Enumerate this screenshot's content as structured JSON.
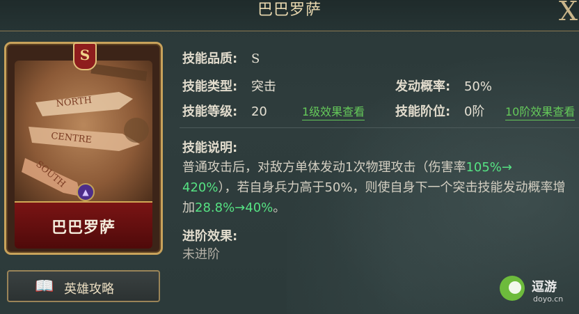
{
  "header": {
    "title": "巴巴罗萨"
  },
  "card": {
    "grade": "S",
    "map_labels": [
      "NORTH",
      "CENTRE",
      "SOUTH"
    ],
    "name": "巴巴罗萨"
  },
  "guide_button": {
    "label": "英雄攻略",
    "icon": "book-icon"
  },
  "skill": {
    "quality_label": "技能品质:",
    "quality_value": "S",
    "type_label": "技能类型:",
    "type_value": "突击",
    "trigger_label": "发动概率:",
    "trigger_value": "50%",
    "level_label": "技能等级:",
    "level_value": "20",
    "level_link": "1级效果查看",
    "tier_label": "技能阶位:",
    "tier_value": "0阶",
    "tier_link": "10阶效果查看",
    "desc_label": "技能说明:",
    "desc": {
      "p1": "普通攻击后，对敌方单体发动1次物理攻击（伤害率",
      "h1": "105%→",
      "h2": "420%",
      "p2": "），若自身兵力高于50%，则使自身下一个突击技能发动概率增加",
      "h3": "28.8%→40%",
      "p3": "。"
    },
    "advance_label": "进阶效果:",
    "advance_value": "未进阶"
  },
  "watermark": {
    "title": "逗游",
    "url": "doyo.cn"
  },
  "colors": {
    "highlight": "#56e383",
    "link": "#65c95a",
    "gold": "#c8a25b"
  }
}
